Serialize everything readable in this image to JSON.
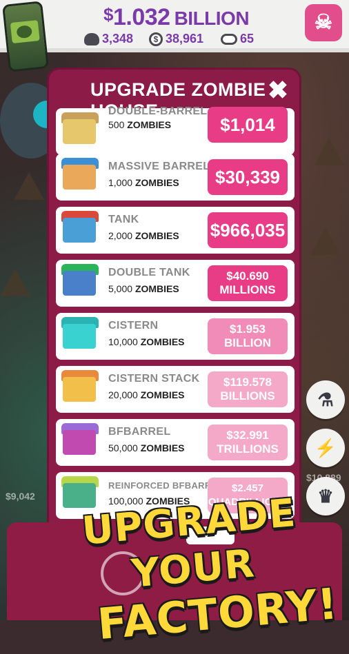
{
  "topbar": {
    "money_symbol": "$",
    "money_value": "1.032",
    "money_unit": "BILLION",
    "stats": [
      {
        "icon": "skull-icon",
        "value": "3,348"
      },
      {
        "icon": "money-bag-icon",
        "value": "38,961"
      },
      {
        "icon": "brain-icon",
        "value": "65"
      }
    ]
  },
  "modal": {
    "title": "UPGRADE ZOMBIE HOUSE",
    "close_glyph": "✖",
    "rows": [
      {
        "name": "DOUBLE-BARREL",
        "count": "500",
        "unit": "ZOMBIES",
        "price": "$1,014"
      },
      {
        "name": "MASSIVE BARREL",
        "count": "1,000",
        "unit": "ZOMBIES",
        "price": "$30,339"
      },
      {
        "name": "TANK",
        "count": "2,000",
        "unit": "ZOMBIES",
        "price": "$966,035"
      },
      {
        "name": "DOUBLE TANK",
        "count": "5,000",
        "unit": "ZOMBIES",
        "price_line1": "$40.690",
        "price_line2": "MILLIONS"
      },
      {
        "name": "CISTERN",
        "count": "10,000",
        "unit": "ZOMBIES",
        "price": "$1.953 BILLION"
      },
      {
        "name": "CISTERN STACK",
        "count": "20,000",
        "unit": "ZOMBIES",
        "price_line1": "$119.578",
        "price_line2": "BILLIONS"
      },
      {
        "name": "BFBARREL",
        "count": "50,000",
        "unit": "ZOMBIES",
        "price_line1": "$32.991",
        "price_line2": "TRILLIONS"
      },
      {
        "name": "REINFORCED BFBARREL",
        "count": "100,000",
        "unit": "ZOMBIES",
        "price_line1": "$2.457",
        "price_line2": "QUADRILLIONS"
      }
    ]
  },
  "background_values": {
    "left_value": "$9,042",
    "right_value": "$10,889"
  },
  "side_buttons": [
    {
      "icon": "flask-icon",
      "glyph": "⚗"
    },
    {
      "icon": "lightning-icon",
      "glyph": "⚡"
    },
    {
      "icon": "trophy-icon",
      "glyph": "♛"
    }
  ],
  "promo": {
    "line1": "UPGRADE YOUR",
    "line2": "FACTORY!"
  },
  "colors": {
    "modal_bg": "#8d1b48",
    "price_button": "#e83c86",
    "money_text": "#7a3aa8",
    "promo_text": "#ffd83a"
  }
}
